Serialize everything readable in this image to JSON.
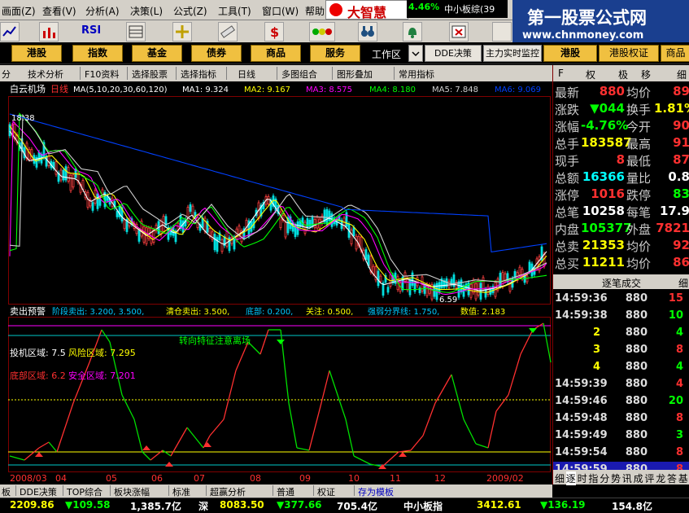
{
  "menu": {
    "items": [
      "画面(Z)",
      "查看(V)",
      "分析(A)",
      "决策(L)",
      "公式(Z)",
      "工具(T)",
      "窗口(W)",
      "帮助"
    ],
    "brand": "大智慧",
    "mini_ticker": {
      "pct": "4.46%",
      "name": "中小板综(39"
    }
  },
  "toolbar": {
    "rsi_label": "RSI"
  },
  "watermark": {
    "line1": "第一股票公式网",
    "line2": "www.chnmoney.com"
  },
  "market_buttons": [
    "港股",
    "指数",
    "基金",
    "债券",
    "商品",
    "服务"
  ],
  "market_tabs": [
    "工作区",
    "DDE决策",
    "主力实时监控",
    "港股",
    "港股权证",
    "商品"
  ],
  "chart_toolbar": [
    "分",
    "技术分析",
    "F10资料",
    "选择股票",
    "选择指标",
    "日线",
    "多图组合",
    "图形叠加",
    "常用指标"
  ],
  "main_chart": {
    "stock_name": "白云机场",
    "period": "日线",
    "ma_label": "MA(5,10,20,30,60,120)",
    "ma_values": [
      {
        "label": "MA1: 9.324",
        "color": "#ffffff"
      },
      {
        "label": "MA2: 9.167",
        "color": "#ffff00"
      },
      {
        "label": "MA3: 8.575",
        "color": "#ff00ff"
      },
      {
        "label": "MA4: 8.180",
        "color": "#00ff00"
      },
      {
        "label": "MA5: 7.848",
        "color": "#d0d0d0"
      },
      {
        "label": "MA6: 9.069",
        "color": "#0040ff"
      }
    ],
    "high_label": "18.38",
    "low_label": "6.59"
  },
  "sub_chart": {
    "title": "卖出预警",
    "params": [
      {
        "label": "阶段卖出: 3.200, 3.500,",
        "color": "#00c8ff"
      },
      {
        "label": "清仓卖出: 3.500,",
        "color": "#ffff00"
      },
      {
        "label": "底部: 0.200,",
        "color": "#00c8ff"
      },
      {
        "label": "关注: 0.500,",
        "color": "#ffff00"
      },
      {
        "label": "强弱分界线: 1.750,",
        "color": "#00c8ff"
      },
      {
        "label": "数值: 2.183",
        "color": "#ffff00"
      }
    ],
    "annotation_top": "转向特征注意离场",
    "zone1_label": "投机区域: 7.5",
    "zone1b_label": "风险区域: 7.295",
    "zone2_label": "底部区域: 6.2",
    "zone2b_label": "安全区域: 7.201"
  },
  "date_axis": [
    "2008/03",
    "04",
    "05",
    "06",
    "07",
    "08",
    "09",
    "10",
    "11",
    "12",
    "2009/02"
  ],
  "right_panel": {
    "tabs": [
      "F",
      "权",
      "极",
      "移",
      "细"
    ],
    "quote": [
      {
        "l1": "最新",
        "v1": "880",
        "c1": "#ff3030",
        "l2": "均价",
        "v2": "89",
        "c2": "#ff3030"
      },
      {
        "l1": "涨跌",
        "v1": "▼044",
        "c1": "#00ff00",
        "l2": "换手",
        "v2": "1.81%",
        "c2": "#ffff00"
      },
      {
        "l1": "涨幅",
        "v1": "-4.76%",
        "c1": "#00ff00",
        "l2": "今开",
        "v2": "90",
        "c2": "#ff3030"
      },
      {
        "l1": "总手",
        "v1": "183587",
        "c1": "#ffff00",
        "l2": "最高",
        "v2": "91",
        "c2": "#ff3030"
      },
      {
        "l1": "现手",
        "v1": "8",
        "c1": "#ff3030",
        "l2": "最低",
        "v2": "87",
        "c2": "#ff3030"
      },
      {
        "l1": "总额",
        "v1": "16366",
        "c1": "#00ffff",
        "l2": "量比",
        "v2": "0.8",
        "c2": "#ffffff"
      },
      {
        "l1": "涨停",
        "v1": "1016",
        "c1": "#ff3030",
        "l2": "跌停",
        "v2": "83",
        "c2": "#00ff00"
      },
      {
        "l1": "总笔",
        "v1": "10258",
        "c1": "#ffffff",
        "l2": "每笔",
        "v2": "17.9",
        "c2": "#ffffff"
      },
      {
        "l1": "内盘",
        "v1": "105377",
        "c1": "#00ff00",
        "l2": "外盘",
        "v2": "7821",
        "c2": "#ff3030"
      },
      {
        "l1": "总卖",
        "v1": "21353",
        "c1": "#ffff00",
        "l2": "均价",
        "v2": "92",
        "c2": "#ff3030"
      },
      {
        "l1": "总买",
        "v1": "11211",
        "c1": "#ffff00",
        "l2": "均价",
        "v2": "86",
        "c2": "#ff3030"
      }
    ],
    "tick_header": "逐笔成交",
    "tick_header2": "细",
    "ticks": [
      {
        "time": "14:59:36",
        "price": "880",
        "vol": "15",
        "vc": "#ff3030"
      },
      {
        "time": "14:59:38",
        "price": "880",
        "vol": "10",
        "vc": "#00ff00"
      },
      {
        "time": "",
        "price": "2 880",
        "vol": "4",
        "vc": "#00ff00"
      },
      {
        "time": "",
        "price": "3 880",
        "vol": "8",
        "vc": "#ff3030"
      },
      {
        "time": "",
        "price": "4 880",
        "vol": "4",
        "vc": "#00ff00"
      },
      {
        "time": "14:59:39",
        "price": "880",
        "vol": "4",
        "vc": "#ff3030"
      },
      {
        "time": "14:59:46",
        "price": "880",
        "vol": "20",
        "vc": "#00ff00"
      },
      {
        "time": "14:59:48",
        "price": "880",
        "vol": "8",
        "vc": "#ff3030"
      },
      {
        "time": "14:59:49",
        "price": "880",
        "vol": "3",
        "vc": "#00ff00"
      },
      {
        "time": "14:59:54",
        "price": "880",
        "vol": "8",
        "vc": "#ff3030"
      },
      {
        "time": "14:59:59",
        "price": "880",
        "vol": "8",
        "vc": "#ff3030"
      }
    ],
    "bottom_tabs": [
      "细",
      "逐",
      "时",
      "指",
      "分",
      "势",
      "讯",
      "成",
      "评",
      "龙",
      "答",
      "基"
    ]
  },
  "bottom_tabs": [
    "板",
    "DDE决策",
    "TOP综合",
    "板块涨幅",
    "标准",
    "超赢分析",
    "普通",
    "权证",
    "存为模板"
  ],
  "status": [
    {
      "text": "2209.86",
      "color": "#ffff00"
    },
    {
      "text": "▼109.58",
      "color": "#00ff00"
    },
    {
      "text": "1,385.7亿",
      "color": "#ffffff"
    },
    {
      "text": "深",
      "color": "#ffffff"
    },
    {
      "text": "8083.50",
      "color": "#ffff00"
    },
    {
      "text": "▼377.66",
      "color": "#00ff00"
    },
    {
      "text": "705.4亿",
      "color": "#ffffff"
    },
    {
      "text": "中小板指",
      "color": "#ffffff"
    },
    {
      "text": "3412.61",
      "color": "#ffff00"
    },
    {
      "text": "▼136.19",
      "color": "#00ff00"
    },
    {
      "text": "154.8亿",
      "color": "#ffffff"
    }
  ]
}
